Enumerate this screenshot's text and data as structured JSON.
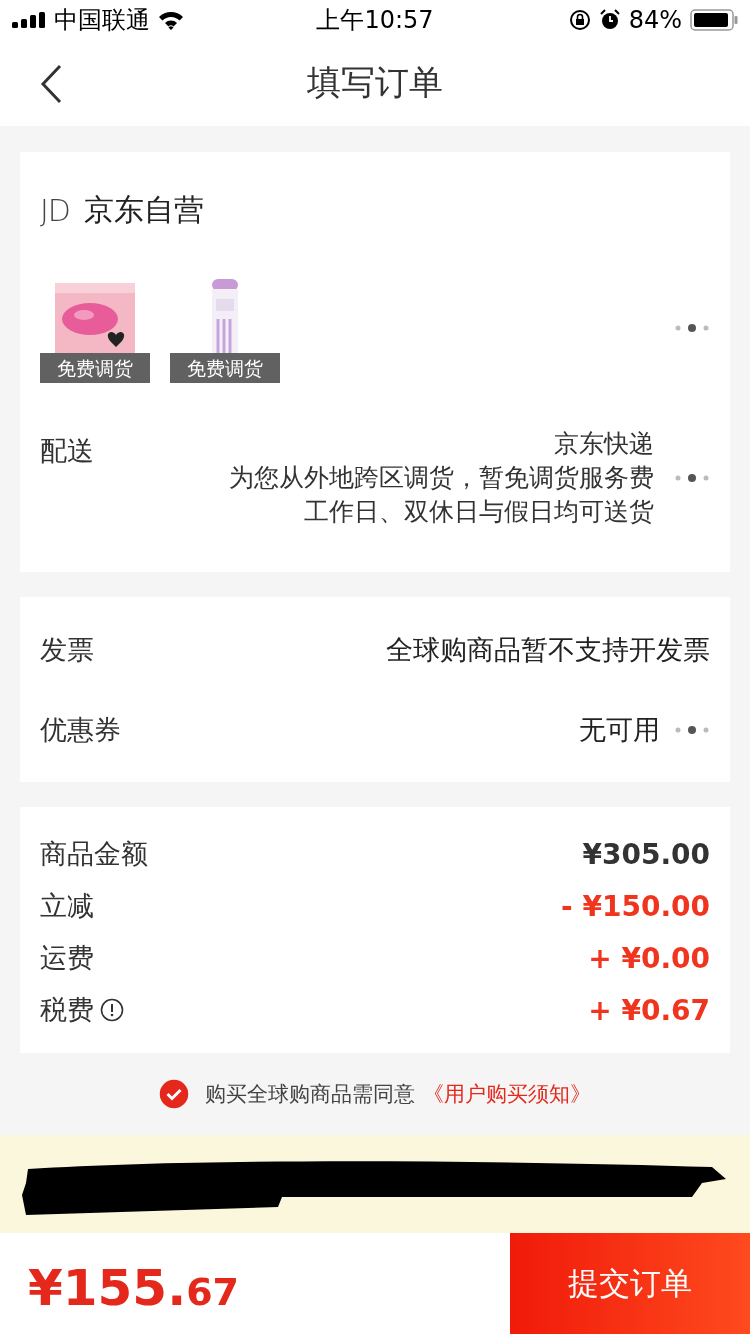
{
  "status_bar": {
    "carrier": "中国联通",
    "time": "上午10:57",
    "battery": "84%"
  },
  "nav": {
    "title": "填写订单"
  },
  "shop": {
    "logo": "JD",
    "name": "京东自营",
    "products": [
      {
        "badge": "免费调货",
        "kind": "lips"
      },
      {
        "badge": "免费调货",
        "kind": "bottle"
      }
    ],
    "delivery": {
      "label": "配送",
      "lines": [
        "京东快递",
        "为您从外地跨区调货，暂免调货服务费",
        "工作日、双休日与假日均可送货"
      ]
    }
  },
  "options": [
    {
      "label": "发票",
      "value": "全球购商品暂不支持开发票",
      "more": false
    },
    {
      "label": "优惠券",
      "value": "无可用",
      "more": true
    }
  ],
  "fees": [
    {
      "label": "商品金额",
      "amount": "¥305.00",
      "kind": "base",
      "info": false
    },
    {
      "label": "立减",
      "amount": "- ¥150.00",
      "kind": "adjust",
      "info": false
    },
    {
      "label": "运费",
      "amount": "+ ¥0.00",
      "kind": "adjust",
      "info": false
    },
    {
      "label": "税费",
      "amount": "+ ¥0.67",
      "kind": "adjust",
      "info": true
    }
  ],
  "agreement": {
    "checked": true,
    "text": "购买全球购商品需同意",
    "link": "《用户购买须知》"
  },
  "footer": {
    "price_main": "¥155.",
    "price_cents": "67",
    "submit": "提交订单"
  }
}
